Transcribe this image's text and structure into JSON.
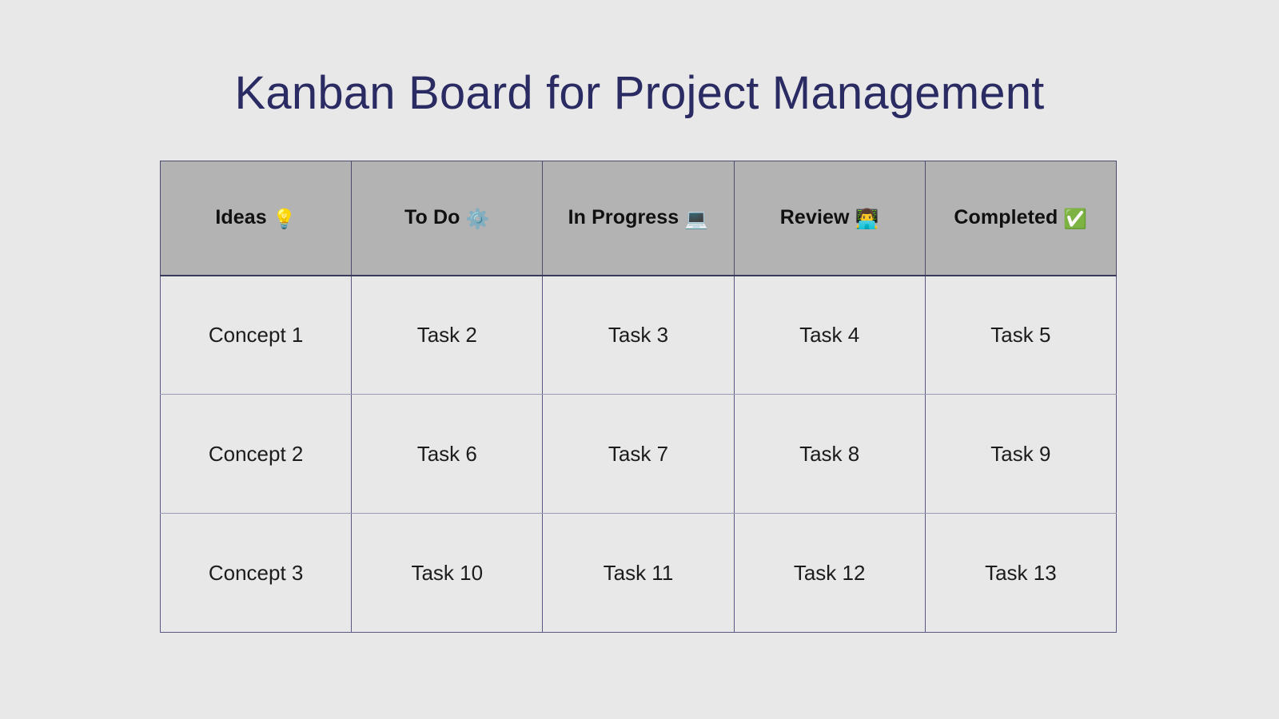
{
  "page": {
    "title": "Kanban Board for Project Management",
    "background_color": "#e8e8e8",
    "title_color": "#2b2b63"
  },
  "board": {
    "header_background_color": "#b3b3b3",
    "cell_background_color": "#e8e8e8",
    "border_color": "#585880",
    "columns": [
      {
        "label": "Ideas",
        "emoji": "💡",
        "icon_name": "lightbulb-icon"
      },
      {
        "label": "To Do",
        "emoji": "⚙️",
        "icon_name": "gear-icon"
      },
      {
        "label": "In Progress",
        "emoji": "💻",
        "icon_name": "laptop-icon"
      },
      {
        "label": "Review",
        "emoji": "👨‍💻",
        "icon_name": "person-at-computer-icon"
      },
      {
        "label": "Completed",
        "emoji": "✅",
        "icon_name": "check-mark-button-icon"
      }
    ],
    "rows": [
      [
        "Concept 1",
        "Task 2",
        "Task 3",
        "Task 4",
        "Task 5"
      ],
      [
        "Concept 2",
        "Task 6",
        "Task 7",
        "Task 8",
        "Task 9"
      ],
      [
        "Concept 3",
        "Task 10",
        "Task 11",
        "Task 12",
        "Task 13"
      ]
    ]
  }
}
